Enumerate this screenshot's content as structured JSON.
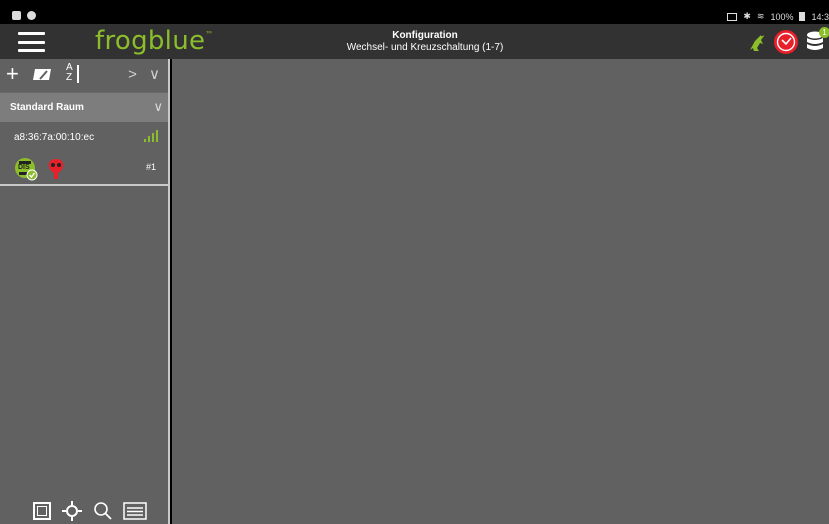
{
  "statusbar": {
    "right_text": "100%",
    "clock_partial": "14:3"
  },
  "app": {
    "logo_text": "frogblue",
    "logo_tm": "™",
    "title": "Konfiguration",
    "subtitle": "Wechsel- und Kreuzschaltung (1-7)",
    "db_badge_count": "1"
  },
  "sidebar": {
    "toolbar": {
      "add_label": "+",
      "sort_top": "A",
      "sort_bottom": "Z",
      "nav_label": "> ∨"
    },
    "room": {
      "name": "Standard Raum",
      "chevron": "∨"
    },
    "device": {
      "mac": "a8:36:7a:00:10:ec",
      "module_label": "DIS",
      "number": "#1"
    }
  },
  "colors": {
    "brand_green": "#8cbd2a",
    "alert_red": "#e8202a",
    "panel_gray": "#616161",
    "header_gray": "#7d7d7d"
  },
  "icons": {
    "menu": "hamburger-icon",
    "status_frog": "frog-icon",
    "status_clock": "clock-icon",
    "database": "database-icon",
    "eraser": "eraser-icon",
    "sort": "sort-az-icon",
    "signal": "signal-strength-icon",
    "module": "dis-module-icon",
    "frog_red": "frog-alert-icon",
    "view_square": "square-view-icon",
    "light": "light-icon",
    "search": "search-icon",
    "list": "list-icon"
  }
}
